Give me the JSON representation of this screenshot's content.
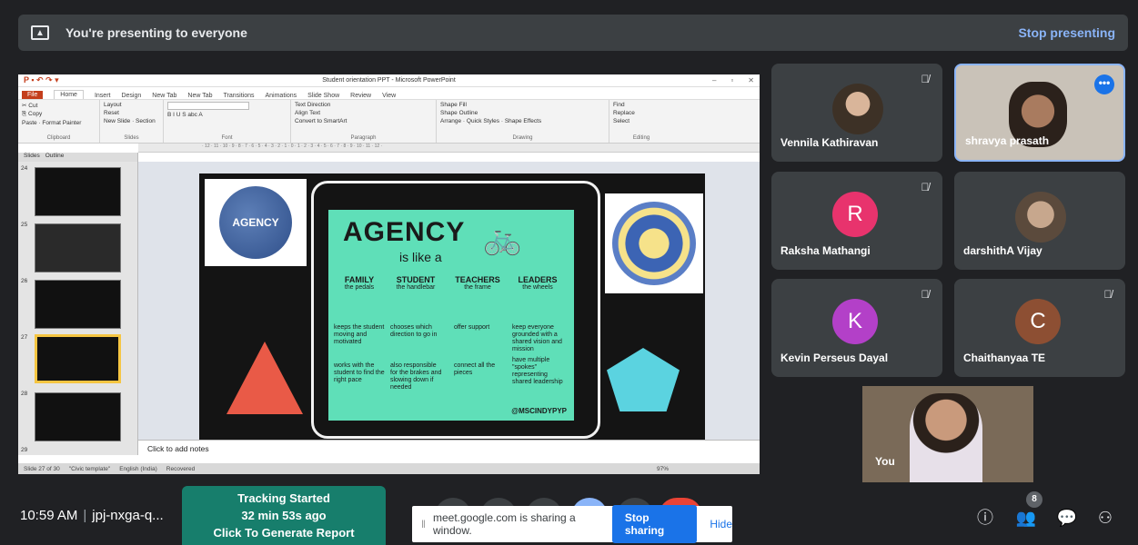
{
  "banner": {
    "text": "You're presenting to everyone",
    "stop_label": "Stop presenting"
  },
  "ppt": {
    "title": "Student orientation PPT - Microsoft PowerPoint",
    "tabs": [
      "File",
      "Home",
      "Insert",
      "Design",
      "New Tab",
      "New Tab",
      "Transitions",
      "Animations",
      "Slide Show",
      "Review",
      "View"
    ],
    "clipboard": {
      "cut": "Cut",
      "copy": "Copy",
      "paste": "Paste",
      "painter": "Format Painter",
      "label": "Clipboard"
    },
    "slides_group": {
      "layout": "Layout",
      "reset": "Reset",
      "new_slide": "New Slide",
      "section": "Section",
      "label": "Slides"
    },
    "font_label": "Font",
    "paragraph": {
      "text_direction": "Text Direction",
      "align_text": "Align Text",
      "smartart": "Convert to SmartArt",
      "label": "Paragraph"
    },
    "drawing": {
      "arrange": "Arrange",
      "quick_styles": "Quick Styles",
      "shape_fill": "Shape Fill",
      "shape_outline": "Shape Outline",
      "shape_effects": "Shape Effects",
      "label": "Drawing"
    },
    "editing": {
      "find": "Find",
      "replace": "Replace",
      "select": "Select",
      "label": "Editing"
    },
    "pane_tabs": [
      "Slides",
      "Outline"
    ],
    "thumb_numbers": [
      "24",
      "25",
      "26",
      "27",
      "28",
      "29"
    ],
    "notes_placeholder": "Click to add notes",
    "status": {
      "slide": "Slide 27 of 30",
      "theme": "\"Civic template\"",
      "lang": "English (India)",
      "recovered": "Recovered",
      "zoom": "97%"
    }
  },
  "slide": {
    "logo_text": "AGENCY",
    "poster_title": "AGENCY",
    "poster_subtitle": "is like a",
    "columns": [
      {
        "head": "FAMILY",
        "sub": "the pedals"
      },
      {
        "head": "STUDENT",
        "sub": "the handlebar"
      },
      {
        "head": "TEACHERS",
        "sub": "the frame"
      },
      {
        "head": "LEADERS",
        "sub": "the wheels"
      }
    ],
    "bullets": [
      "keeps the student moving and motivated",
      "chooses which direction to go in",
      "offer support",
      "keep everyone grounded with a shared vision and mission",
      "works with the student to find the right pace",
      "also responsible for the brakes and slowing down if needed",
      "connect all the pieces",
      "have multiple \"spokes\" representing shared leadership"
    ],
    "signature": "@MSCINDYPYP"
  },
  "participants": [
    {
      "name": "Vennila Kathiravan",
      "type": "photo"
    },
    {
      "name": "shravya prasath",
      "type": "photo"
    },
    {
      "name": "Raksha Mathangi",
      "initial": "R",
      "color": "#e8336d"
    },
    {
      "name": "darshithA Vijay",
      "type": "photo"
    },
    {
      "name": "Kevin Perseus Dayal",
      "initial": "K",
      "color": "#b340c8"
    },
    {
      "name": "Chaithanyaa TE",
      "initial": "C",
      "color": "#8d4f33"
    }
  ],
  "self_label": "You",
  "bottom": {
    "time": "10:59 AM",
    "separator": "|",
    "meeting_code": "jpj-nxga-q...",
    "tracking": {
      "line1": "Tracking Started",
      "line2": "32 min 53s ago",
      "line3": "Click To Generate Report"
    },
    "share": {
      "text": "meet.google.com is sharing a window.",
      "stop": "Stop sharing",
      "hide": "Hide"
    },
    "people_count": "8"
  }
}
